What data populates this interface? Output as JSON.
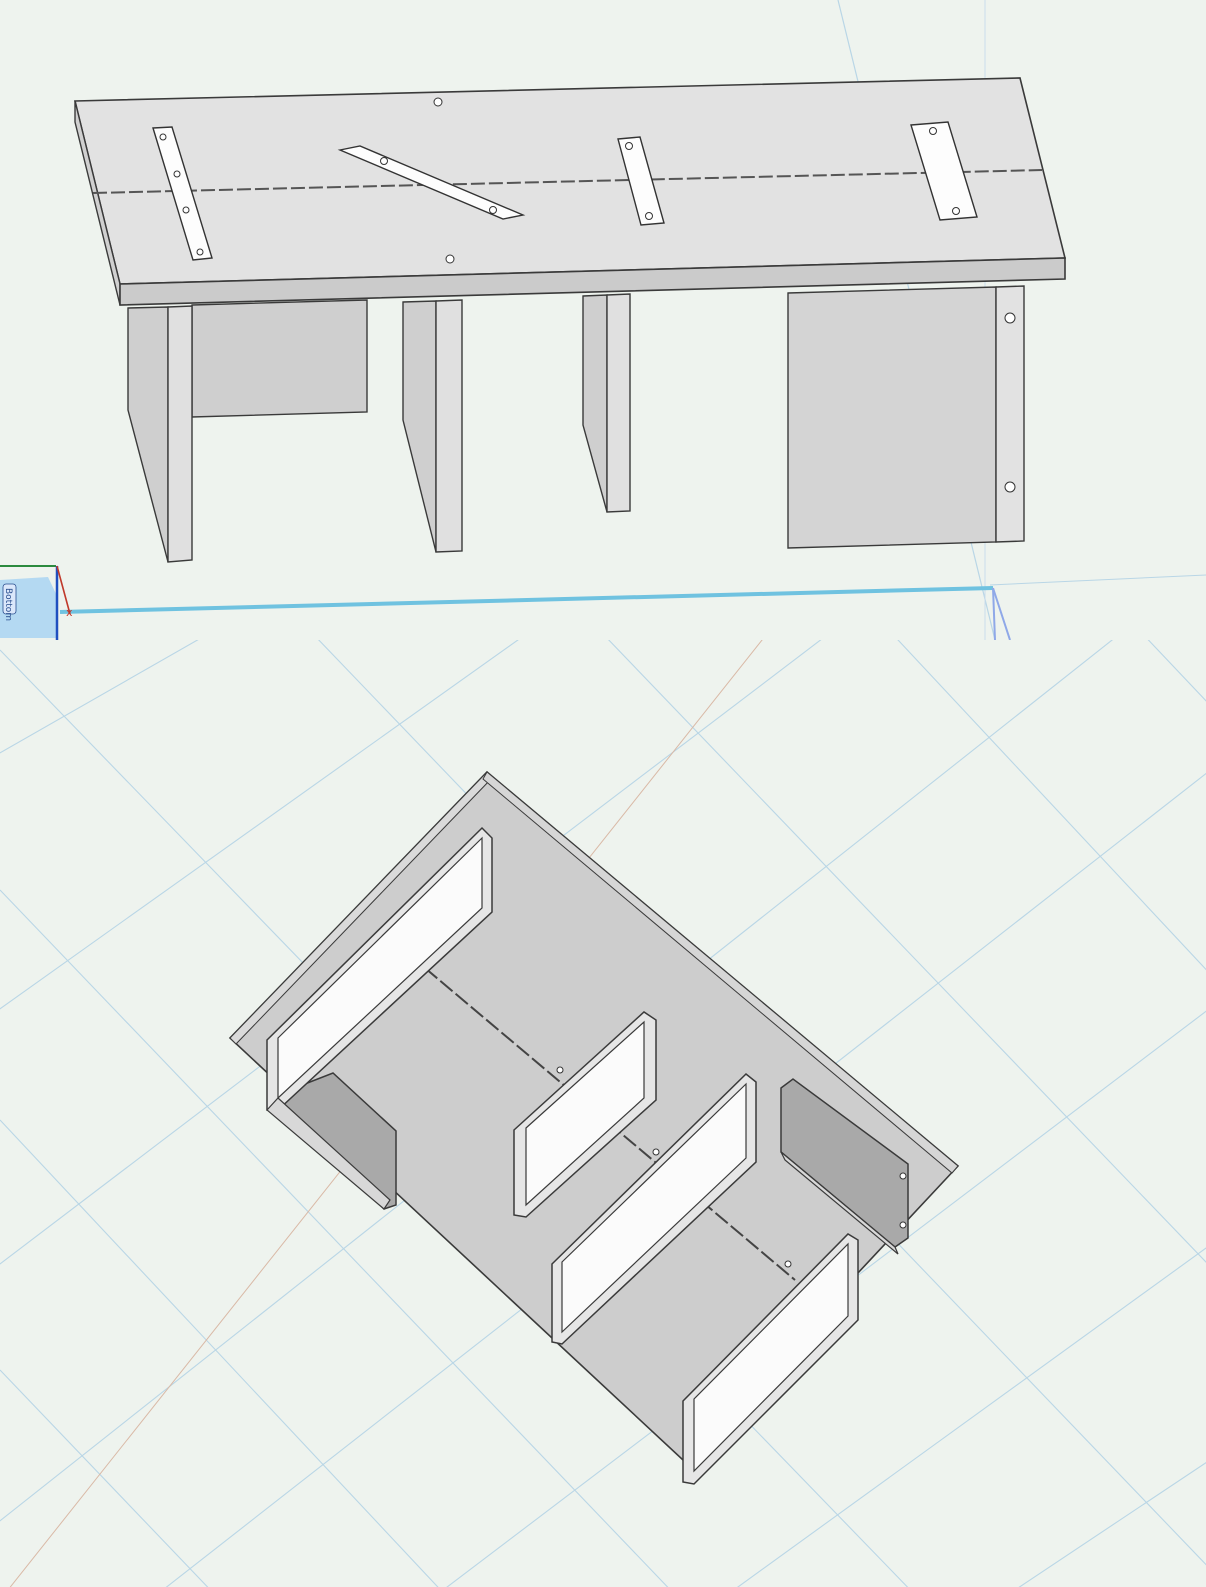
{
  "view_tag": {
    "label": "Bottom"
  },
  "colors": {
    "background": "#eef3ee",
    "grid_line": "#b9d6e6",
    "model_face": "#e3e3e3",
    "model_side": "#cfcfcf",
    "model_shadow": "#b9b9b9",
    "model_edge": "#3a3a3a",
    "highlight_face": "#fafafa",
    "working_plane_line": "#6fc2e0",
    "axis_x": "#c0392b",
    "axis_y": "#2b8a3e",
    "axis_z": "#1f4fbf"
  },
  "icons": [
    "axis-gizmo-icon",
    "view-tag-icon"
  ]
}
